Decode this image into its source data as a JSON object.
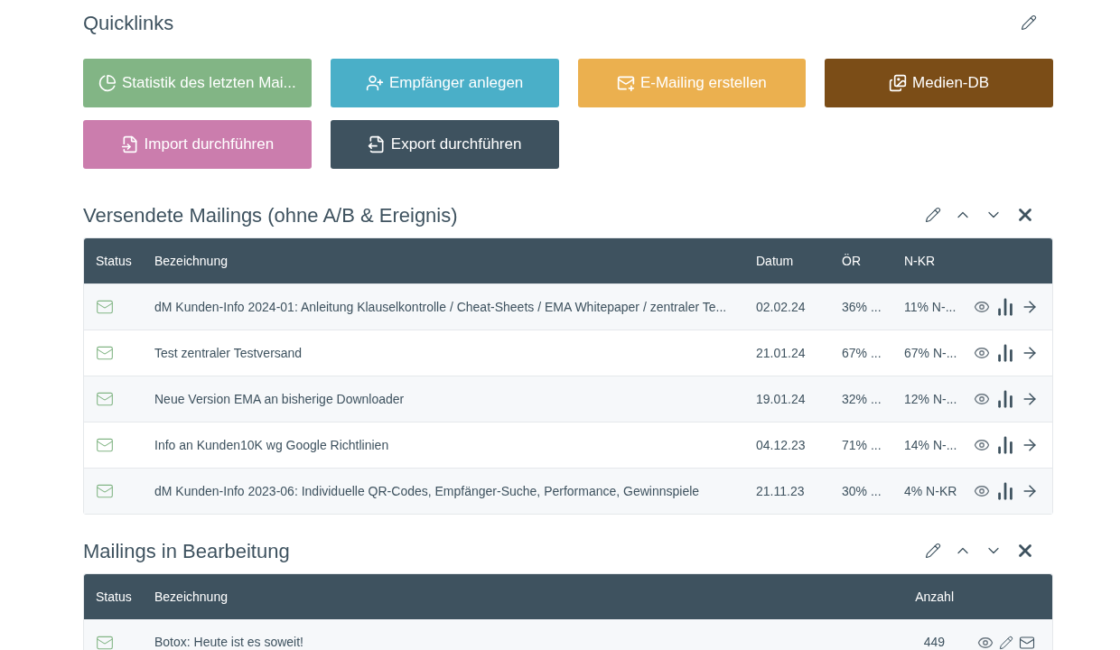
{
  "quicklinks": {
    "title": "Quicklinks",
    "buttons": [
      {
        "label": "Statistik des letzten Mai...",
        "color": "#82b585"
      },
      {
        "label": "Empfänger anlegen",
        "color": "#4aafc8"
      },
      {
        "label": "E-Mailing erstellen",
        "color": "#ebb04f"
      },
      {
        "label": "Medien-DB",
        "color": "#7b4d17"
      },
      {
        "label": "Import durchführen",
        "color": "#cb7dad"
      },
      {
        "label": "Export durchführen",
        "color": "#3e525f"
      }
    ]
  },
  "sent_mailings": {
    "title": "Versendete Mailings (ohne A/B & Ereignis)",
    "columns": [
      "Status",
      "Bezeichnung",
      "Datum",
      "ÖR",
      "N-KR"
    ],
    "rows": [
      {
        "name": "dM Kunden-Info 2024-01: Anleitung Klauselkontrolle / Cheat-Sheets / EMA Whitepaper / zentraler Te...",
        "date": "02.02.24",
        "or": "36% ...",
        "nkr": "11% N-..."
      },
      {
        "name": "Test zentraler Testversand",
        "date": "21.01.24",
        "or": "67% ...",
        "nkr": "67% N-..."
      },
      {
        "name": "Neue Version EMA an bisherige Downloader",
        "date": "19.01.24",
        "or": "32% ...",
        "nkr": "12% N-..."
      },
      {
        "name": "Info an Kunden10K wg Google Richtlinien",
        "date": "04.12.23",
        "or": "71% ...",
        "nkr": "14% N-..."
      },
      {
        "name": "dM Kunden-Info 2023-06: Individuelle QR-Codes, Empfänger-Suche, Performance, Gewinnspiele",
        "date": "21.11.23",
        "or": "30% ...",
        "nkr": "4% N-KR"
      }
    ]
  },
  "draft_mailings": {
    "title": "Mailings in Bearbeitung",
    "columns": [
      "Status",
      "Bezeichnung",
      "Anzahl"
    ],
    "rows": [
      {
        "name": "Botox: Heute ist es soweit!",
        "count": "449"
      }
    ]
  }
}
